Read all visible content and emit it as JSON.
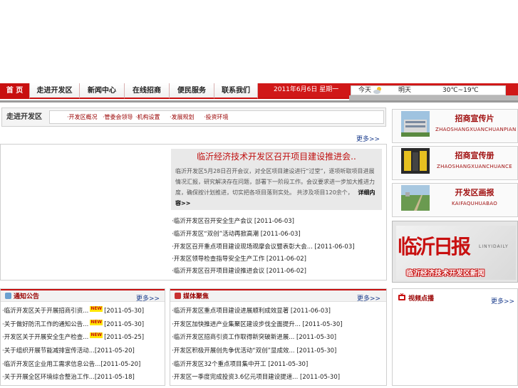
{
  "nav": {
    "items": [
      "首 页",
      "走进开发区",
      "新闻中心",
      "在线招商",
      "便民服务",
      "联系我们"
    ],
    "date": "2011年6月6日 星期一",
    "weather_label_1": "今天",
    "weather_label_2": "明天",
    "temperature": "30℃~19℃"
  },
  "subbar": {
    "title": "走进开发区",
    "links": [
      "·开发区概况",
      "·管委会领导",
      "·机构设置",
      "·发展规划",
      "·投资环境"
    ]
  },
  "main": {
    "more": "更多>>",
    "headline_title": "临沂经济技术开发区召开项目建设推进会..",
    "headline_summary": "临沂开发区5月28日召开会议，对全区项目建设进行“过堂”，逐项听取项目进展情况汇报，研究解决存在问题，部署下一阶段工作。会议要求进一步加大推进力度，确保按计划推进，切实把各项目落到实处。 共涉及项目120余个，",
    "headline_detail": "详细内容>>",
    "news": [
      {
        "title": "·临沂开发区召开安全生产会议",
        "date": "[2011-06-03]"
      },
      {
        "title": "·临沂开发区“双创”活动再掀高潮",
        "date": "[2011-06-03]"
      },
      {
        "title": "·开发区召开重点项目建设现场观摩会议暨表彰大会...",
        "date": "[2011-06-03]"
      },
      {
        "title": "·开发区领导检查指导安全生产工作",
        "date": "[2011-06-02]"
      },
      {
        "title": "·临沂开发区召开项目建设推进会议",
        "date": "[2011-06-02]"
      }
    ]
  },
  "promos": [
    {
      "title": "招商宣传片",
      "subtitle": "ZHAOSHANGXUANCHUANPIAN"
    },
    {
      "title": "招商宣传册",
      "subtitle": "ZHAOSHANGXUANCHUANCE"
    },
    {
      "title": "开发区画报",
      "subtitle": "KAIFAQUHUABAO"
    }
  ],
  "daily": {
    "brand": "临沂日报",
    "brand_en": "LINYIDAILY",
    "footer": "临沂经济技术开发区新闻"
  },
  "notice": {
    "title": "通知公告",
    "more": "更多>>",
    "new_badge": "NEW",
    "items": [
      {
        "title": "·临沂开发区关于开展招商引资...",
        "date": "[2011-05-30]",
        "is_new": true
      },
      {
        "title": "·关于做好防汛工作的通知公告...",
        "date": "[2011-05-30]",
        "is_new": true
      },
      {
        "title": "·开发区关于开展安全生产检查...",
        "date": "[2011-05-25]",
        "is_new": true
      },
      {
        "title": "·关于组织开展节能减排宣传活动...",
        "date": "[2011-05-20]",
        "is_new": false
      },
      {
        "title": "·临沂开发区企业用工需求信息公告...",
        "date": "[2011-05-20]",
        "is_new": false
      },
      {
        "title": "·关于开展全区环境综合整治工作...",
        "date": "[2011-05-18]",
        "is_new": false
      }
    ]
  },
  "media": {
    "title": "媒体聚焦",
    "more": "更多>>",
    "items": [
      {
        "title": "·临沂开发区重点项目建设进展顺利成效显著",
        "date": "[2011-06-03]"
      },
      {
        "title": "·开发区加快推进产业集聚区建设步伐全面提升...",
        "date": "[2011-05-30]"
      },
      {
        "title": "·临沂开发区招商引资工作取得新突破新进展...",
        "date": "[2011-05-30]"
      },
      {
        "title": "·开发区积极开展创先争优活动“双创”显成效...",
        "date": "[2011-05-30]"
      },
      {
        "title": "·临沂开发区32个重点项目集中开工",
        "date": "[2011-05-30]"
      },
      {
        "title": "·开发区一季度完成投资3.6亿元项目建设提速...",
        "date": "[2011-05-30]"
      }
    ]
  },
  "video": {
    "title": "视频点播",
    "more": "更多>>"
  }
}
